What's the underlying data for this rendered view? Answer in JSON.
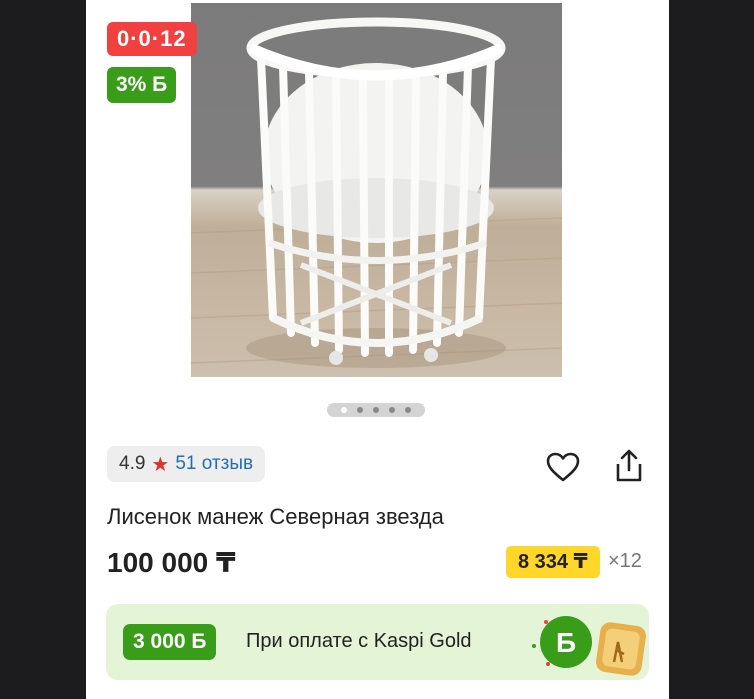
{
  "product": {
    "promo_badge": "0·0·12",
    "bonus_badge": "3% Б",
    "rating": "4.9",
    "reviews": "51 отзыв",
    "title": "Лисенок манеж Северная звезда",
    "price": "100 000 ₸",
    "installment_amount": "8 334 ₸",
    "installment_count": "×12"
  },
  "gallery": {
    "slide_count": 5,
    "active_slide": 1
  },
  "kaspi_gold": {
    "bonus": "3 000 Б",
    "text": "При оплате с Kaspi Gold",
    "logo_letter": "Б"
  },
  "icons": {
    "rating": "star-icon",
    "favorite": "heart-icon",
    "share": "share-icon"
  },
  "colors": {
    "promo": "#f04040",
    "bonus": "#3a9d1a",
    "installment": "#ffd629",
    "link": "#1f6fb8",
    "banner": "#e3f5d6"
  }
}
